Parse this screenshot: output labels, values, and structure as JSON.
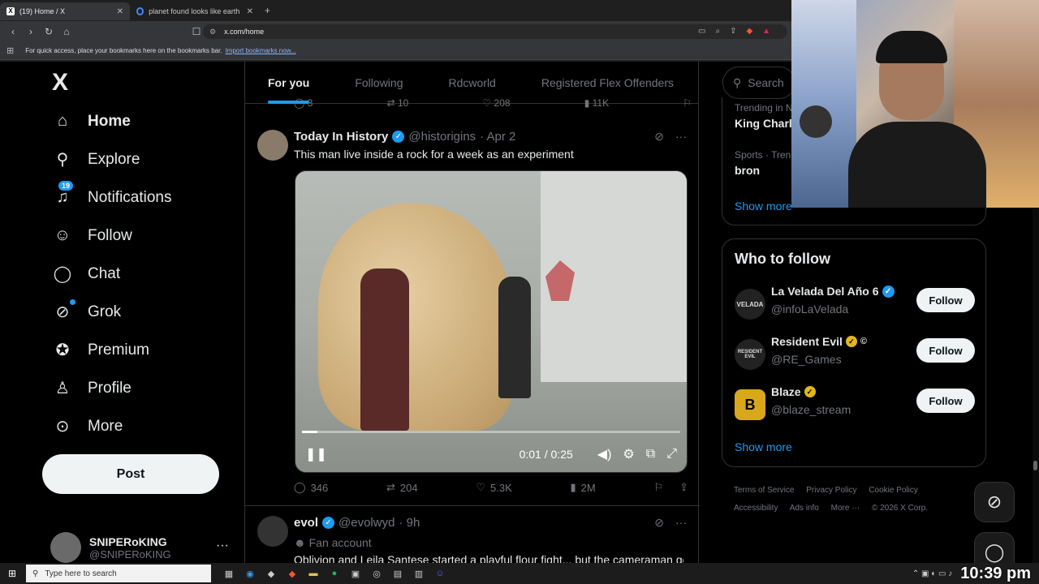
{
  "browser": {
    "tabs": [
      {
        "title": "(19) Home / X",
        "favicon": "x-icon",
        "active": true
      },
      {
        "title": "planet found looks like earth - Goog",
        "favicon": "google-icon",
        "active": false
      }
    ],
    "url": "x.com/home",
    "bookmarks_hint": "For quick access, place your bookmarks here on the bookmarks bar.",
    "bookmarks_link": "Import bookmarks now..."
  },
  "sidebar": {
    "logo": "X",
    "items": [
      {
        "label": "Home",
        "icon": "home-icon",
        "active": true
      },
      {
        "label": "Explore",
        "icon": "search-icon"
      },
      {
        "label": "Notifications",
        "icon": "bell-icon",
        "badge": "19"
      },
      {
        "label": "Follow",
        "icon": "person-add-icon"
      },
      {
        "label": "Chat",
        "icon": "chat-icon"
      },
      {
        "label": "Grok",
        "icon": "grok-icon"
      },
      {
        "label": "Premium",
        "icon": "verified-icon"
      },
      {
        "label": "Profile",
        "icon": "person-icon"
      },
      {
        "label": "More",
        "icon": "more-circle-icon"
      }
    ],
    "post_label": "Post",
    "account": {
      "name": "SNIPERoKING",
      "handle": "@SNIPERoKING"
    }
  },
  "feed": {
    "tabs": [
      "For you",
      "Following",
      "Rdcworld",
      "Registered Flex Offenders"
    ],
    "active_tab": "For you",
    "prev_actions": {
      "replies": "3",
      "reposts": "10",
      "likes": "208",
      "views": "11K"
    },
    "tweets": [
      {
        "name": "Today In History",
        "handle": "@historigins",
        "date": "· Apr 2",
        "text": "This man live inside a rock for a week as an experiment",
        "video": {
          "current": "0:01",
          "duration": "0:25",
          "progress": 0.04
        },
        "actions": {
          "replies": "346",
          "reposts": "204",
          "likes": "5.3K",
          "views": "2M"
        }
      },
      {
        "name": "evol",
        "handle": "@evolwyd",
        "date": "· 9h",
        "label": "Fan account",
        "text": "Oblivion and Leila Santese started a playful flour fight... but the cameraman got caught during it at Leila Santese a little TOO lol"
      }
    ]
  },
  "right": {
    "search_placeholder": "Search",
    "trends": [
      {
        "category": "Trending in N",
        "name": "King Charl"
      },
      {
        "category": "Sports · Trend",
        "name": "bron"
      }
    ],
    "trends_show_more": "Show more",
    "who_to_follow": {
      "title": "Who to follow",
      "accounts": [
        {
          "name": "La Velada Del Año 6",
          "handle": "@infoLaVelada",
          "badge": "blue",
          "avatar": "VELADA"
        },
        {
          "name": "Resident Evil",
          "handle": "@RE_Games",
          "badge": "gold",
          "avatar": "RESIDENT EVIL"
        },
        {
          "name": "Blaze",
          "handle": "@blaze_stream",
          "badge": "gold",
          "avatar": "B"
        }
      ],
      "follow_label": "Follow",
      "show_more": "Show more"
    },
    "footer": [
      "Terms of Service",
      "Privacy Policy",
      "Cookie Policy",
      "Accessibility",
      "Ads info",
      "More ···",
      "© 2026 X Corp."
    ]
  },
  "taskbar": {
    "search_placeholder": "Type here to search",
    "time": "10:39 pm"
  },
  "colors": {
    "accent": "#1d9bf0",
    "background": "#000000",
    "gold_badge": "#e2b719"
  }
}
